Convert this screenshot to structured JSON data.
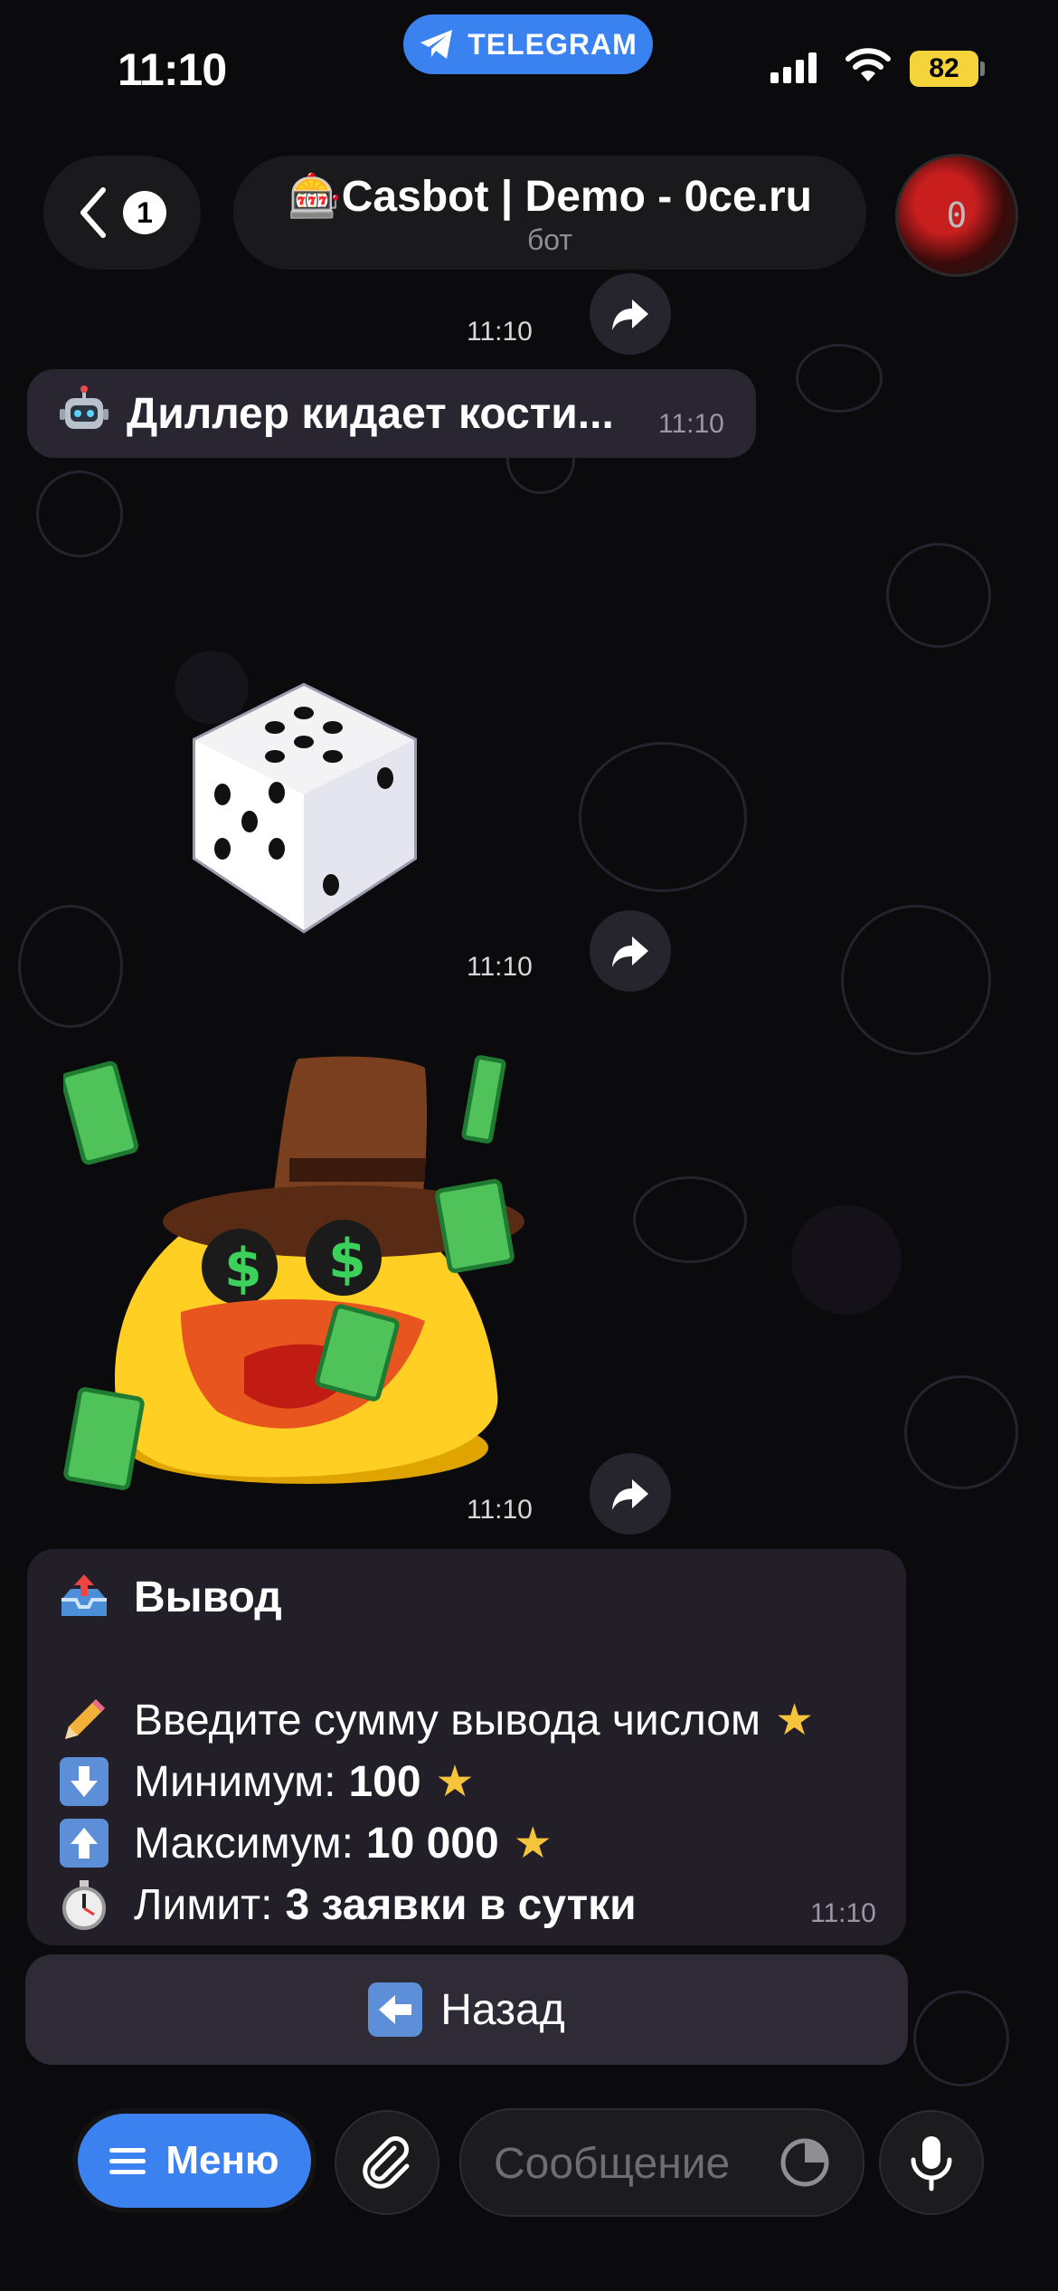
{
  "status_bar": {
    "time": "11:10",
    "app_pill": "TELEGRAM",
    "battery": "82"
  },
  "header": {
    "back_count": "1",
    "title": "🎰Casbot | Demo - 0ce.ru",
    "subtitle": "бот",
    "avatar_text": "0"
  },
  "messages": [
    {
      "id": "m0",
      "time": "11:10"
    },
    {
      "id": "m1",
      "text": "Диллер кидает кости...",
      "time": "11:10",
      "icon": "robot-icon"
    },
    {
      "id": "m2",
      "type": "dice",
      "time": "11:10"
    },
    {
      "id": "m3",
      "type": "sticker",
      "time": "11:10"
    }
  ],
  "withdraw": {
    "title": "Вывод",
    "line1": "Введите сумму вывода числом",
    "min_label": "Минимум:",
    "min_value": "100",
    "max_label": "Максимум:",
    "max_value": "10 000",
    "limit_label": "Лимит:",
    "limit_value": "3 заявки в сутки",
    "time": "11:10"
  },
  "keyboard": {
    "back_label": "Назад"
  },
  "input_bar": {
    "menu_label": "Меню",
    "placeholder": "Сообщение"
  },
  "colors": {
    "accent": "#3b82f0",
    "star": "#f6c43b",
    "bubble": "#221f28"
  }
}
